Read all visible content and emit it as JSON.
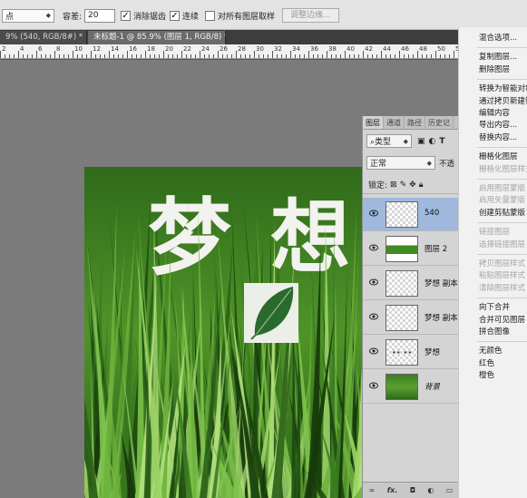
{
  "options_bar": {
    "mode_value": "点",
    "tolerance_label": "容差:",
    "tolerance_value": "20",
    "antialias_label": "消除锯齿",
    "contiguous_label": "连续",
    "sample_all_label": "对所有图层取样",
    "refine_edge_label": "调整边缘..."
  },
  "tabs": [
    {
      "label": "9% (540, RGB/8#) *",
      "close": "×"
    },
    {
      "label": "未标题-1 @ 85.9% (图层 1, RGB/8) *",
      "close": "×"
    }
  ],
  "ruler_numbers": [
    "2",
    "4",
    "6",
    "8",
    "10",
    "12",
    "14",
    "16",
    "18",
    "20",
    "22",
    "24",
    "26",
    "28",
    "30",
    "32",
    "34",
    "36",
    "38",
    "40",
    "42",
    "44",
    "46",
    "48",
    "50",
    "52"
  ],
  "canvas": {
    "text_chars": [
      "梦",
      "想"
    ]
  },
  "layers_panel": {
    "tabs": [
      "图层",
      "通道",
      "路径",
      "历史记"
    ],
    "filter_label": "类型",
    "blend_mode": "正常",
    "opacity_label": "不透",
    "lock_label": "锁定:",
    "layers": [
      {
        "name": "540",
        "selected": true,
        "italic": false,
        "thumb": "white-text"
      },
      {
        "name": "图层 2",
        "selected": false,
        "italic": false,
        "thumb": "grass-strip"
      },
      {
        "name": "梦想 副本",
        "selected": false,
        "italic": false,
        "thumb": "empty"
      },
      {
        "name": "梦想 副本",
        "selected": false,
        "italic": false,
        "thumb": "empty"
      },
      {
        "name": "梦想",
        "selected": false,
        "italic": false,
        "thumb": "text-dots"
      },
      {
        "name": "背景",
        "selected": false,
        "italic": true,
        "thumb": "grass"
      }
    ],
    "footer_icons": [
      "link-icon",
      "fx-icon",
      "mask-icon",
      "adjust-icon",
      "folder-icon"
    ]
  },
  "context_menu": {
    "items": [
      {
        "label": "混合选项...",
        "disabled": false
      },
      {
        "sep": true
      },
      {
        "label": "复制图层...",
        "disabled": false
      },
      {
        "label": "删除图层",
        "disabled": false
      },
      {
        "sep": true
      },
      {
        "label": "转换为智能对象",
        "disabled": false
      },
      {
        "label": "通过拷贝新建智能对象",
        "disabled": false
      },
      {
        "label": "编辑内容",
        "disabled": false
      },
      {
        "label": "导出内容...",
        "disabled": false
      },
      {
        "label": "替换内容...",
        "disabled": false
      },
      {
        "sep": true
      },
      {
        "label": "栅格化图层",
        "disabled": false
      },
      {
        "label": "栅格化图层样式",
        "disabled": true
      },
      {
        "sep": true
      },
      {
        "label": "启用图层蒙版",
        "disabled": true
      },
      {
        "label": "启用矢量蒙版",
        "disabled": true
      },
      {
        "label": "创建剪贴蒙版",
        "disabled": false
      },
      {
        "sep": true
      },
      {
        "label": "链接图层",
        "disabled": true
      },
      {
        "label": "选择链接图层",
        "disabled": true
      },
      {
        "sep": true
      },
      {
        "label": "拷贝图层样式",
        "disabled": true
      },
      {
        "label": "粘贴图层样式",
        "disabled": true
      },
      {
        "label": "清除图层样式",
        "disabled": true
      },
      {
        "sep": true
      },
      {
        "label": "向下合并",
        "disabled": false
      },
      {
        "label": "合并可见图层",
        "disabled": false
      },
      {
        "label": "拼合图像",
        "disabled": false
      },
      {
        "sep": true
      },
      {
        "label": "无颜色",
        "disabled": false
      },
      {
        "label": "红色",
        "disabled": false
      },
      {
        "label": "橙色",
        "disabled": false
      }
    ]
  },
  "colors": {
    "grass_dark": "#1f4d12",
    "grass_light": "#6fb33a",
    "selection_blue": "#9fb9dd"
  }
}
